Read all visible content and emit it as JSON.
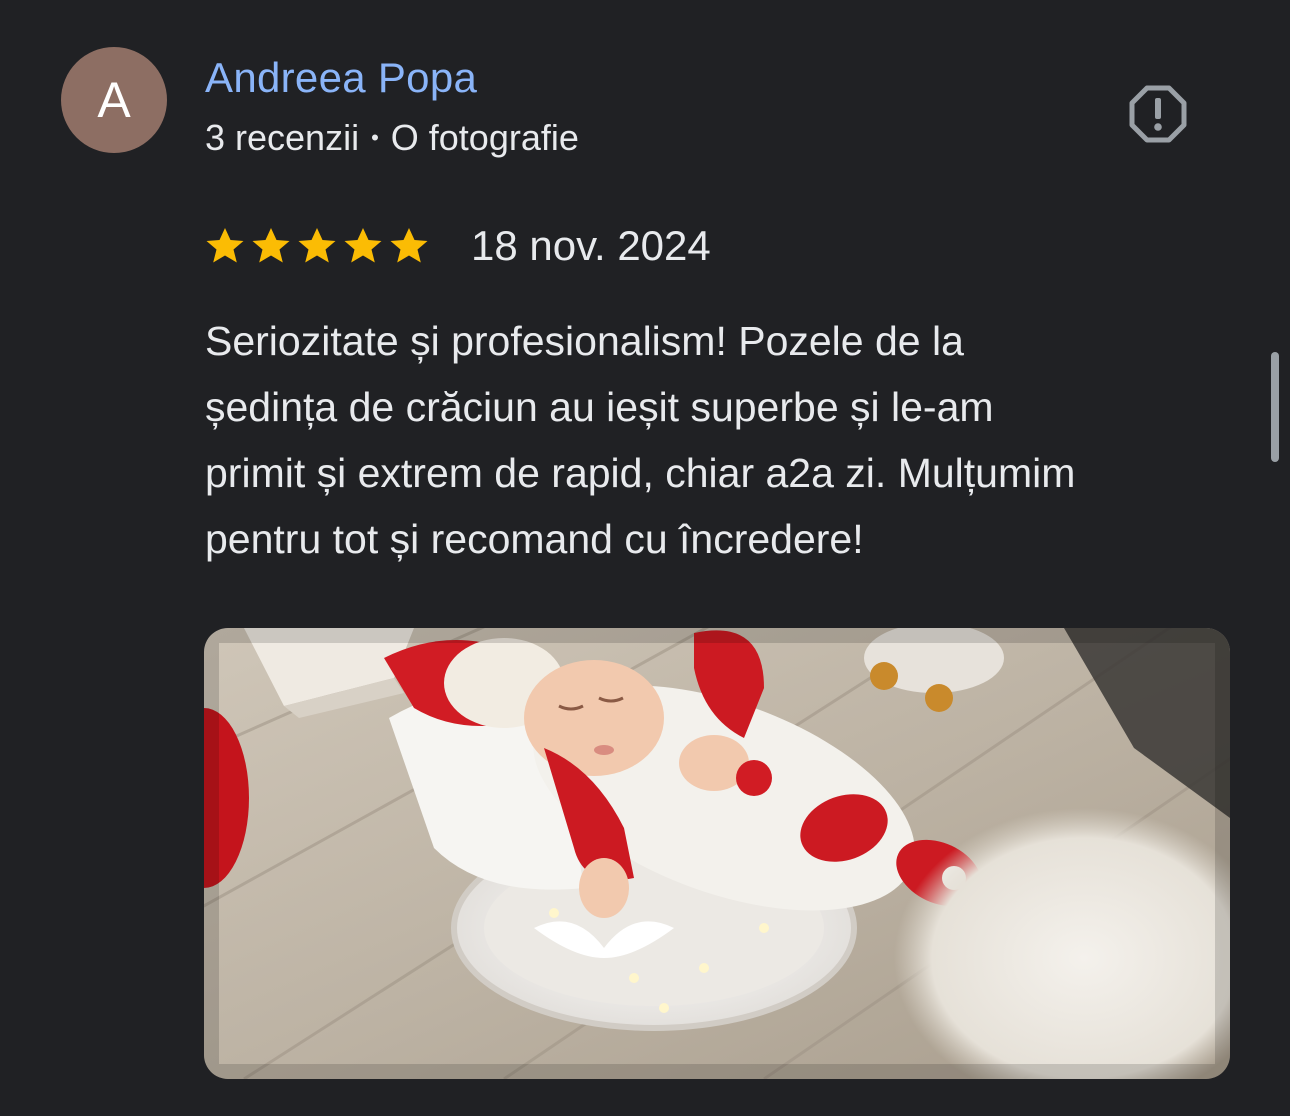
{
  "review": {
    "author": {
      "initial": "A",
      "name": "Andreea Popa",
      "reviews_count": "3 recenzii",
      "separator": "•",
      "photos_count": "O fotografie"
    },
    "rating": 5,
    "date": "18 nov. 2024",
    "text_lines": [
      "Seriozitate și profesionalism! Pozele de la",
      "ședința de crăciun au ieșit superbe și le-am",
      "primit și extrem de rapid, chiar a2a zi. Mulțumim",
      "pentru tot și recomand cu încredere!"
    ]
  },
  "icons": {
    "report": "report-flag-octagon-exclamation-icon",
    "star": "star-filled-icon"
  },
  "colors": {
    "background": "#202124",
    "author_link": "#8ab4f8",
    "avatar_bg": "#8d6e63",
    "star": "#fbbc04",
    "text": "#e8eaed"
  }
}
